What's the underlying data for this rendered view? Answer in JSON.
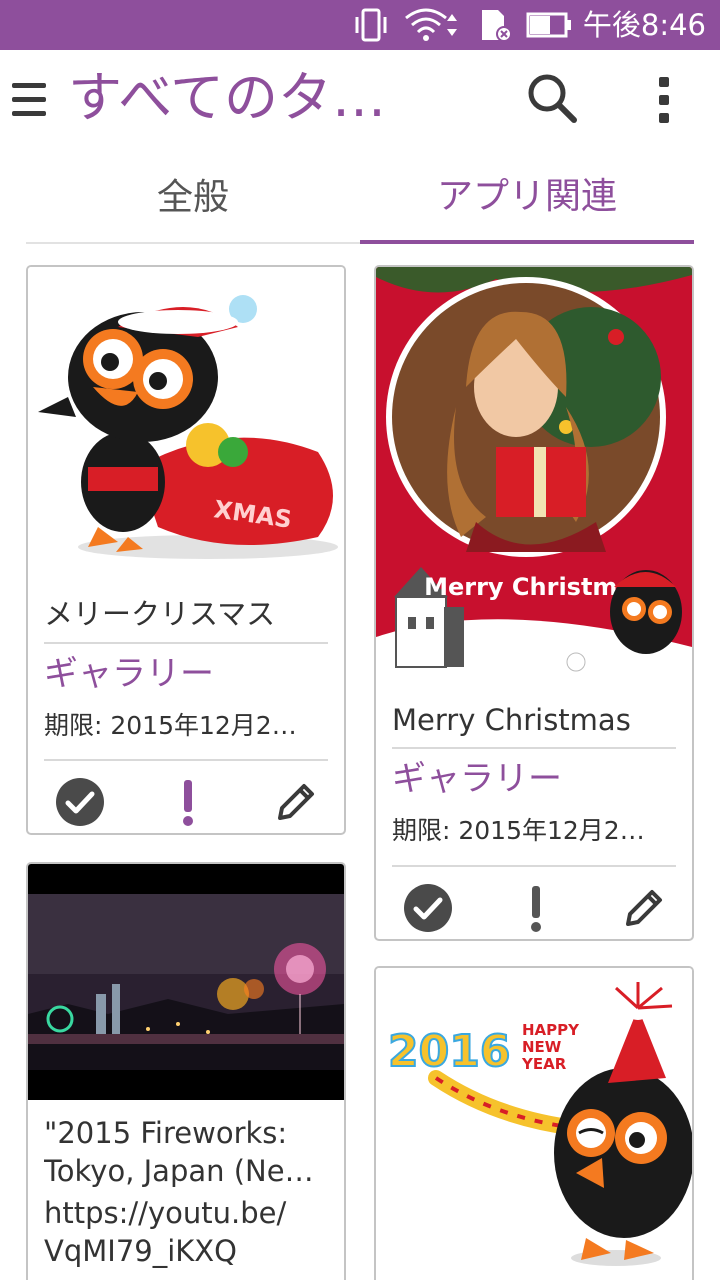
{
  "status_bar": {
    "time": "午後8:46",
    "icons": [
      "vibrate-icon",
      "wifi-icon",
      "sd-card-error-icon",
      "battery-icon"
    ]
  },
  "toolbar": {
    "title": "すべてのタ…",
    "icons": [
      "menu-icon",
      "search-icon",
      "more-vert-icon"
    ]
  },
  "tabs": [
    {
      "label": "全般",
      "selected": false
    },
    {
      "label": "アプリ関連",
      "selected": true
    }
  ],
  "colors": {
    "accent": "#8e4f9c",
    "status_bar": "#8e4f9c",
    "important_general": "#8e4f9c",
    "important_app": "#555555"
  },
  "cards": [
    {
      "title": "メリークリスマス",
      "category": "ギャラリー",
      "deadline": "期限: 2015年12月2…",
      "image_text": "XMAS",
      "actions": [
        "check-circle-icon",
        "exclamation-icon",
        "pencil-icon"
      ]
    },
    {
      "title": "Merry Christmas",
      "category": "ギャラリー",
      "deadline": "期限: 2015年12月2…",
      "image_text": "Merry Christmas",
      "actions": [
        "check-circle-icon",
        "exclamation-icon",
        "pencil-icon"
      ]
    },
    {
      "title": "\"2015 Fireworks: Tokyo, Japan (Ne…",
      "link_line1": "https://youtu.be/",
      "link_line2": "VqMI79_iKXQ"
    },
    {
      "image_text_year": "2016",
      "image_text_1": "HAPPY",
      "image_text_2": "NEW",
      "image_text_3": "YEAR"
    }
  ]
}
